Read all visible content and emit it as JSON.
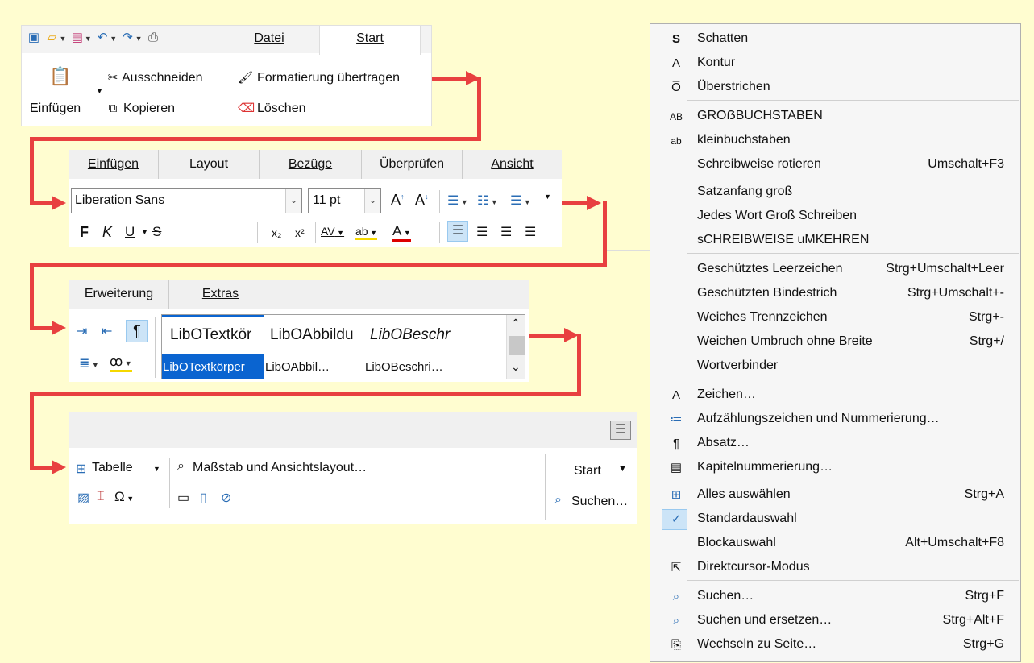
{
  "colors": {
    "background": "#fffdd0",
    "arrow": "#e84040",
    "selection": "#0a64d0",
    "menu_check_bg": "#cce4f7"
  },
  "toolbar1": {
    "tabs": [
      "Datei",
      "Start"
    ],
    "paste_label": "Einfügen",
    "cut_label": "Ausschneiden",
    "copy_label": "Kopieren",
    "clone_label": "Formatierung übertragen",
    "clear_label": "Löschen",
    "icons": [
      "new-doc-icon",
      "open-folder-icon",
      "save-icon",
      "undo-icon",
      "redo-icon",
      "print-icon"
    ]
  },
  "toolbar2": {
    "tabs": [
      "Einfügen",
      "Layout",
      "Bezüge",
      "Überprüfen",
      "Ansicht"
    ],
    "font_name": "Liberation Sans",
    "font_size": "11 pt",
    "bold": "F",
    "italic": "K",
    "underline": "U",
    "strike": "S",
    "subscript": "x₂",
    "superscript": "x²"
  },
  "toolbar3": {
    "tabs": [
      "Erweiterung",
      "Extras"
    ],
    "styles_row1": [
      "LibOTextkör",
      "LibOAbbildu",
      "LibOBeschr"
    ],
    "styles_row2": [
      "LibOTextkörper",
      "LibOAbbil…",
      "LibOBeschri…"
    ]
  },
  "toolbar4": {
    "table_label": "Tabelle",
    "zoom_label": "Maßstab und Ansichtslayout…",
    "start_label": "Start",
    "search_label": "Suchen…"
  },
  "menu": {
    "items": [
      {
        "icon": "shadow-icon",
        "glyph": "S",
        "label": "Schatten",
        "shortcut": ""
      },
      {
        "icon": "outline-icon",
        "glyph": "A",
        "label": "Kontur",
        "shortcut": ""
      },
      {
        "icon": "overline-icon",
        "glyph": "O̅",
        "label": "Überstrichen",
        "shortcut": ""
      },
      {
        "icon": "uppercase-icon",
        "glyph": "AB",
        "label": "GROẞBUCHSTABEN",
        "shortcut": ""
      },
      {
        "icon": "lowercase-icon",
        "glyph": "ab",
        "label": "kleinbuchstaben",
        "shortcut": ""
      },
      {
        "icon": "",
        "glyph": "",
        "label": "Schreibweise rotieren",
        "shortcut": "Umschalt+F3"
      },
      {
        "icon": "",
        "glyph": "",
        "label": "Satzanfang groß",
        "shortcut": ""
      },
      {
        "icon": "",
        "glyph": "",
        "label": "Jedes Wort Groß Schreiben",
        "shortcut": ""
      },
      {
        "icon": "",
        "glyph": "",
        "label": "sCHREIBWEISE uMKEHREN",
        "shortcut": ""
      },
      {
        "icon": "",
        "glyph": "",
        "label": "Geschütztes Leerzeichen",
        "shortcut": "Strg+Umschalt+Leer"
      },
      {
        "icon": "",
        "glyph": "",
        "label": "Geschützten Bindestrich",
        "shortcut": "Strg+Umschalt+-"
      },
      {
        "icon": "",
        "glyph": "",
        "label": "Weiches Trennzeichen",
        "shortcut": "Strg+-"
      },
      {
        "icon": "",
        "glyph": "",
        "label": "Weichen Umbruch ohne Breite",
        "shortcut": "Strg+/"
      },
      {
        "icon": "",
        "glyph": "",
        "label": "Wortverbinder",
        "shortcut": ""
      },
      {
        "icon": "character-icon",
        "glyph": "A",
        "label": "Zeichen…",
        "shortcut": ""
      },
      {
        "icon": "bullets-icon",
        "glyph": "≔",
        "label": "Aufzählungszeichen und Nummerierung…",
        "shortcut": ""
      },
      {
        "icon": "paragraph-icon",
        "glyph": "¶",
        "label": "Absatz…",
        "shortcut": ""
      },
      {
        "icon": "chapter-numbering-icon",
        "glyph": "▤",
        "label": "Kapitelnummerierung…",
        "shortcut": ""
      },
      {
        "icon": "select-all-icon",
        "glyph": "⊞",
        "label": "Alles auswählen",
        "shortcut": "Strg+A"
      },
      {
        "icon": "checkmark-icon",
        "glyph": "✓",
        "label": "Standardauswahl",
        "shortcut": ""
      },
      {
        "icon": "",
        "glyph": "",
        "label": "Blockauswahl",
        "shortcut": "Alt+Umschalt+F8"
      },
      {
        "icon": "cursor-icon",
        "glyph": "⇱",
        "label": "Direktcursor-Modus",
        "shortcut": ""
      },
      {
        "icon": "search-icon",
        "glyph": "⌕",
        "label": "Suchen…",
        "shortcut": "Strg+F"
      },
      {
        "icon": "find-replace-icon",
        "glyph": "⌕",
        "label": "Suchen und ersetzen…",
        "shortcut": "Strg+Alt+F"
      },
      {
        "icon": "goto-page-icon",
        "glyph": "⎘",
        "label": "Wechseln zu Seite…",
        "shortcut": "Strg+G"
      }
    ]
  }
}
